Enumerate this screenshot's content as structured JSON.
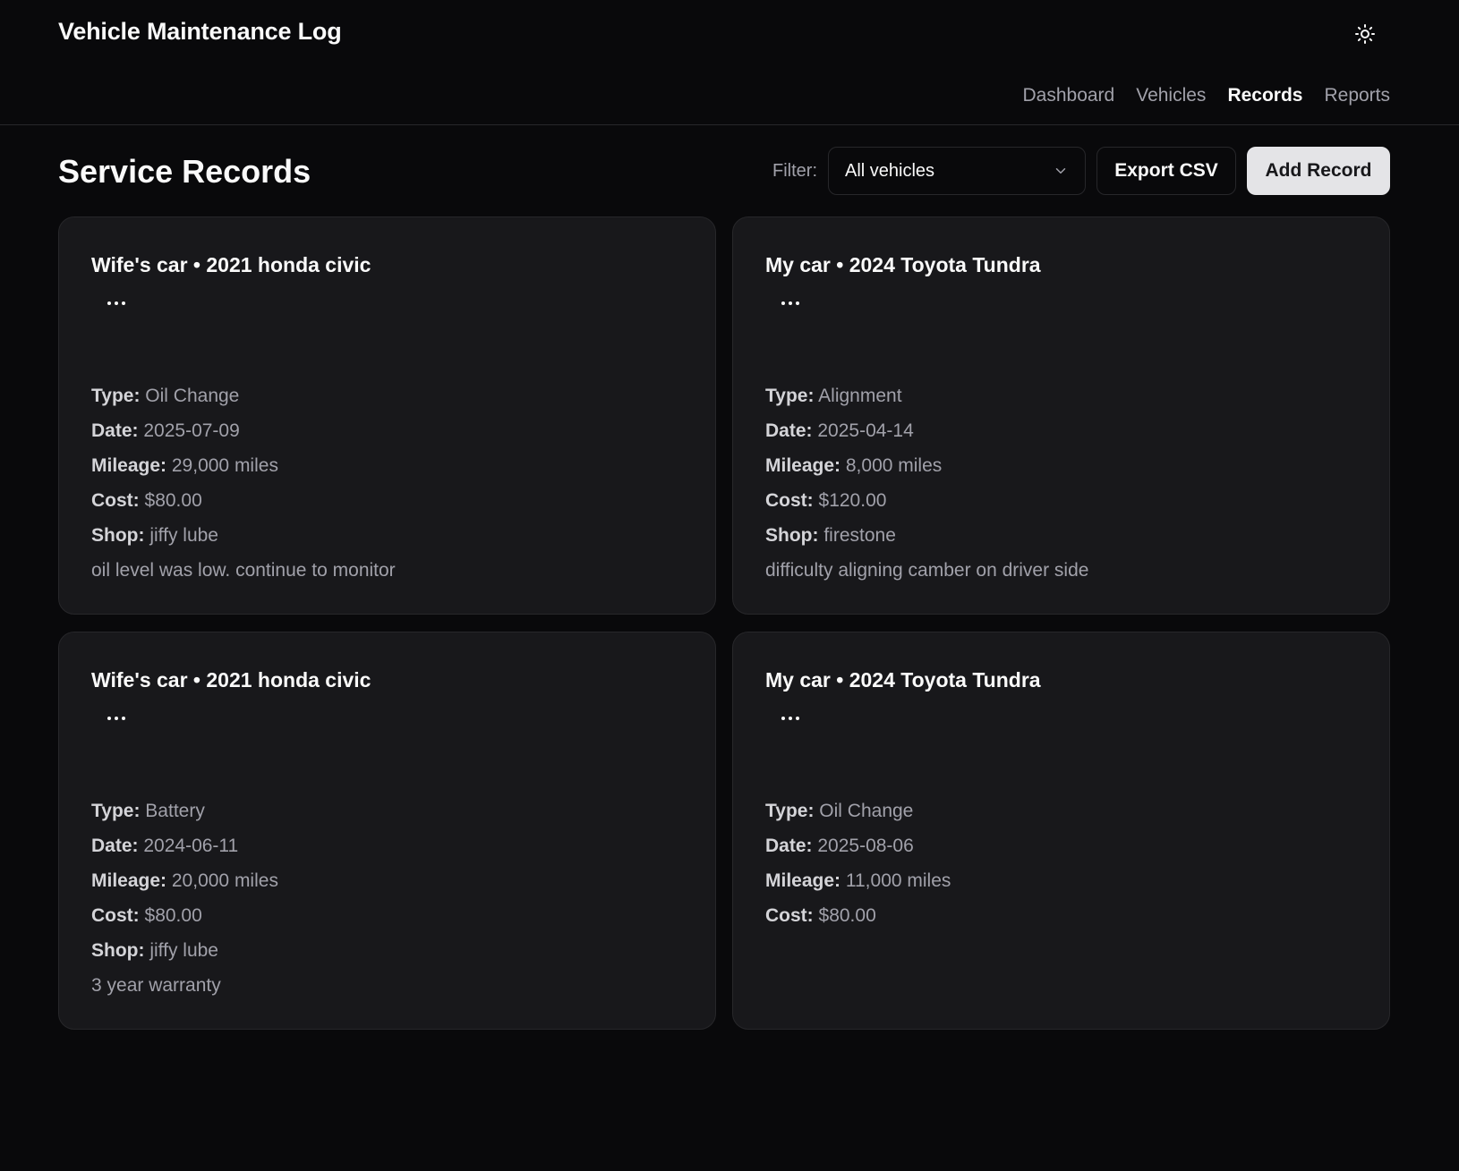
{
  "app": {
    "title": "Vehicle Maintenance Log",
    "theme_icon": "sun-icon"
  },
  "nav": {
    "items": [
      {
        "label": "Dashboard",
        "active": false
      },
      {
        "label": "Vehicles",
        "active": false
      },
      {
        "label": "Records",
        "active": true
      },
      {
        "label": "Reports",
        "active": false
      }
    ]
  },
  "page": {
    "title": "Service Records"
  },
  "filter": {
    "label": "Filter:",
    "value": "All vehicles",
    "icon": "chevron-down-icon"
  },
  "actions": {
    "export_label": "Export CSV",
    "add_label": "Add Record"
  },
  "labels": {
    "type": "Type:",
    "date": "Date:",
    "mileage": "Mileage:",
    "cost": "Cost:",
    "shop": "Shop:"
  },
  "records": [
    {
      "title": "Wife's car • 2021 honda civic",
      "menu": "...",
      "type": "Oil Change",
      "date": "2025-07-09",
      "mileage": "29,000 miles",
      "cost": "$80.00",
      "shop": "jiffy lube",
      "notes": "oil level was low. continue to monitor"
    },
    {
      "title": "My car • 2024 Toyota Tundra",
      "menu": "...",
      "type": "Alignment",
      "date": "2025-04-14",
      "mileage": "8,000 miles",
      "cost": "$120.00",
      "shop": "firestone",
      "notes": "difficulty aligning camber on driver side"
    },
    {
      "title": "Wife's car • 2021 honda civic",
      "menu": "...",
      "type": "Battery",
      "date": "2024-06-11",
      "mileage": "20,000 miles",
      "cost": "$80.00",
      "shop": "jiffy lube",
      "notes": "3 year warranty"
    },
    {
      "title": "My car • 2024 Toyota Tundra",
      "menu": "...",
      "type": "Oil Change",
      "date": "2025-08-06",
      "mileage": "11,000 miles",
      "cost": "$80.00"
    }
  ],
  "colors": {
    "background": "#09090b",
    "card": "#18181b",
    "border": "#27272a",
    "muted_text": "#a1a1aa",
    "primary_button": "#e4e4e7"
  }
}
